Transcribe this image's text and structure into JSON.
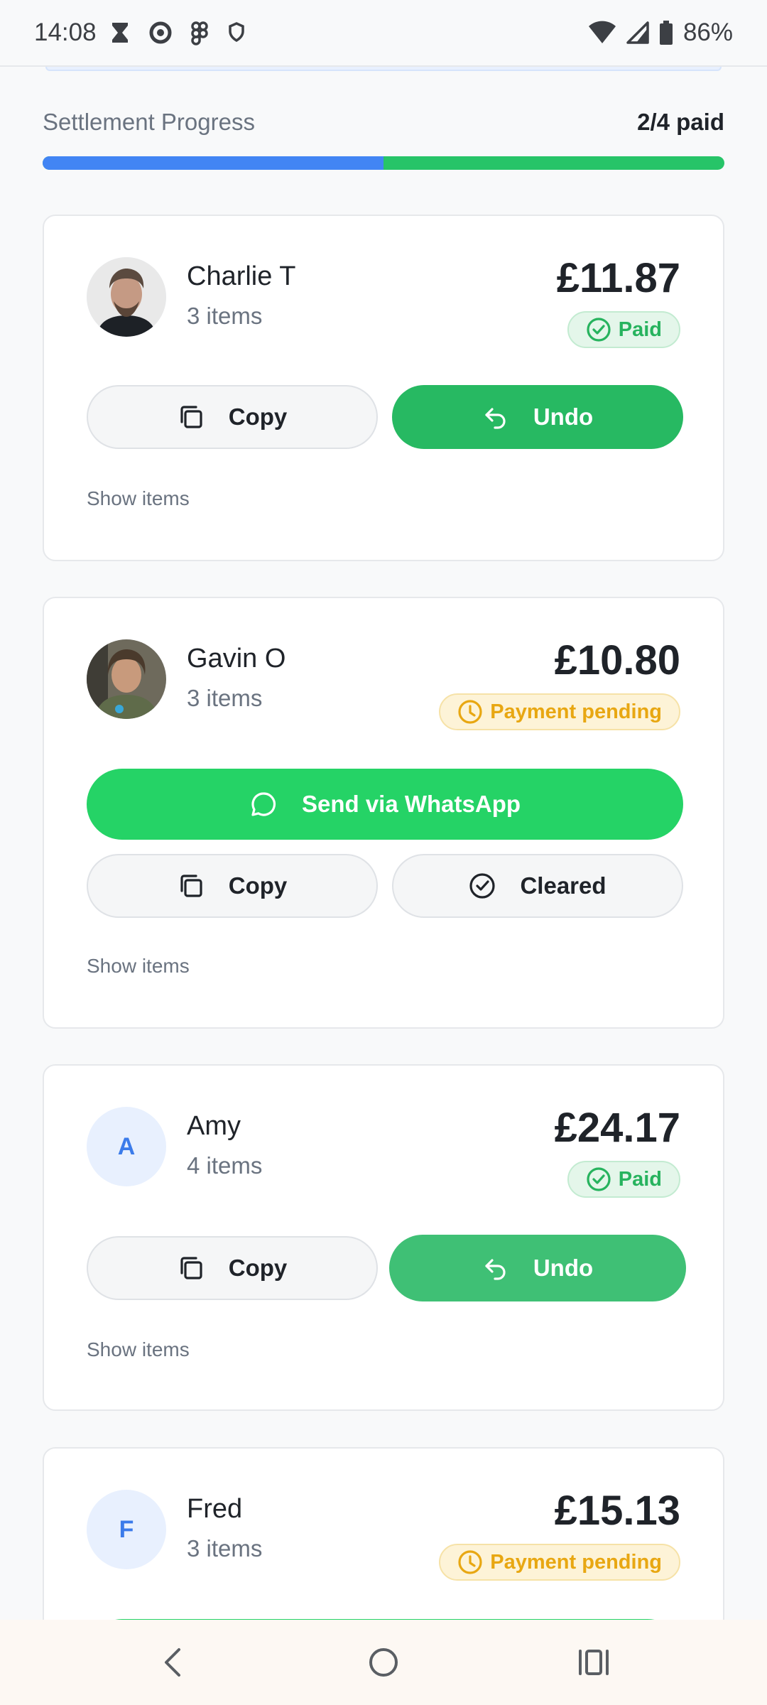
{
  "status_bar": {
    "time": "14:08",
    "battery": "86%"
  },
  "progress": {
    "label": "Settlement Progress",
    "count": "2/4 paid",
    "fraction_paid": 0.5
  },
  "colors": {
    "blue": "#4285f4",
    "green": "#27b962",
    "whatsapp": "#25d366",
    "pending": "#e8a712"
  },
  "cards": [
    {
      "name": "Charlie T",
      "items": "3 items",
      "amount": "£11.87",
      "status": "Paid",
      "copy_label": "Copy",
      "undo_label": "Undo",
      "show_items": "Show items"
    },
    {
      "name": "Gavin O",
      "items": "3 items",
      "amount": "£10.80",
      "status": "Payment pending",
      "whatsapp_label": "Send via WhatsApp",
      "copy_label": "Copy",
      "cleared_label": "Cleared",
      "show_items": "Show items"
    },
    {
      "name": "Amy",
      "initial": "A",
      "items": "4 items",
      "amount": "£24.17",
      "status": "Paid",
      "copy_label": "Copy",
      "undo_label": "Undo",
      "show_items": "Show items"
    },
    {
      "name": "Fred",
      "initial": "F",
      "items": "3 items",
      "amount": "£15.13",
      "status": "Payment pending"
    }
  ]
}
